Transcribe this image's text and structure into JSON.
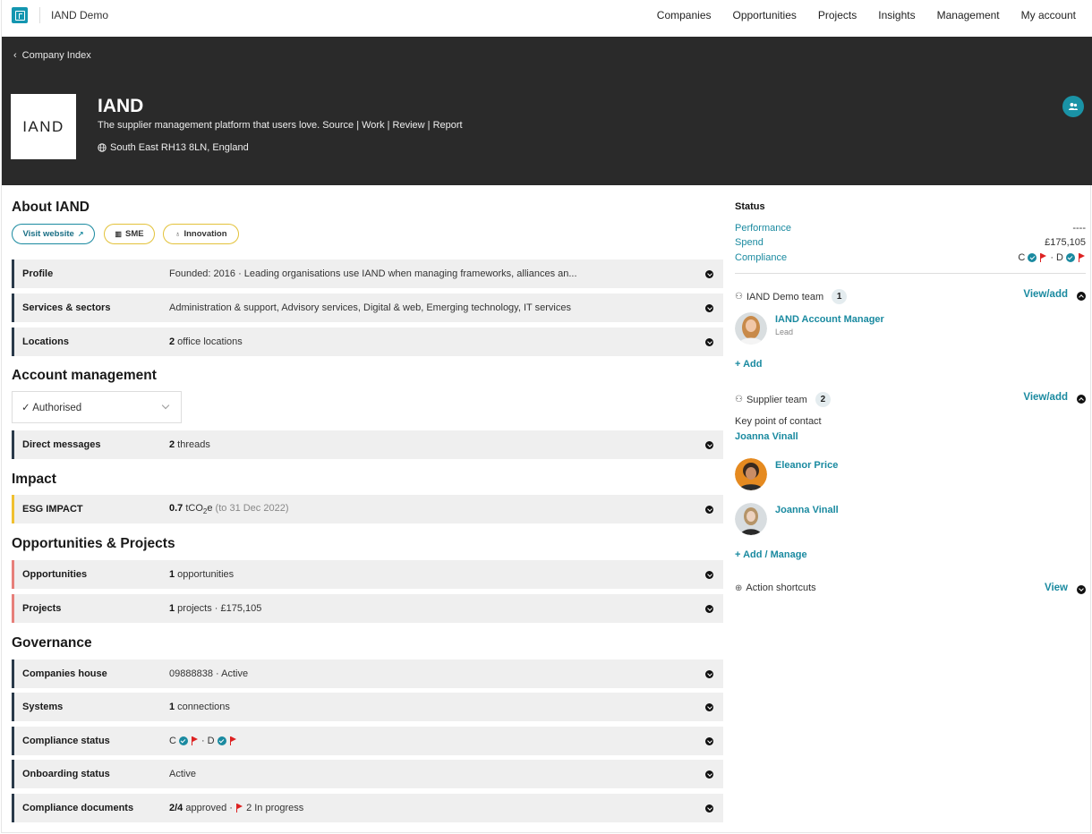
{
  "app": {
    "title": "IAND Demo"
  },
  "nav": [
    "Companies",
    "Opportunities",
    "Projects",
    "Insights",
    "Management",
    "My account"
  ],
  "hero": {
    "back": "Company Index",
    "logo_text": "IAND",
    "name": "IAND",
    "tagline": "The supplier management platform that users love. Source | Work | Review | Report",
    "location": "South East RH13 8LN, England"
  },
  "about": {
    "title": "About IAND",
    "pills": {
      "website": "Visit website",
      "sme": "SME",
      "innovation": "Innovation"
    },
    "rows": [
      {
        "label": "Profile",
        "value": "Founded: 2016 · Leading organisations use IAND when managing frameworks, alliances an..."
      },
      {
        "label": "Services & sectors",
        "value": "Administration & support, Advisory services, Digital & web, Emerging technology, IT services"
      },
      {
        "label": "Locations",
        "bold": "2",
        "value": " office locations"
      }
    ]
  },
  "account": {
    "title": "Account management",
    "select_value": "✓ Authorised",
    "dm_label": "Direct messages",
    "dm_bold": "2",
    "dm_value": " threads"
  },
  "impact": {
    "title": "Impact",
    "label": "ESG IMPACT",
    "bold": "0.7",
    "unit": " tCO",
    "unit_sub": "2",
    "unit_end": "e",
    "muted": " (to 31 Dec 2022)"
  },
  "opps": {
    "title": "Opportunities & Projects",
    "opp_label": "Opportunities",
    "opp_bold": "1",
    "opp_value": " opportunities",
    "proj_label": "Projects",
    "proj_bold": "1",
    "proj_value": " projects · £175,105"
  },
  "governance": {
    "title": "Governance",
    "ch_label": "Companies house",
    "ch_value": "09888838 · Active",
    "sys_label": "Systems",
    "sys_bold": "1",
    "sys_value": " connections",
    "comp_label": "Compliance status",
    "comp_c": "C",
    "comp_sep": "· D",
    "onb_label": "Onboarding status",
    "onb_value": "Active",
    "docs_label": "Compliance documents",
    "docs_bold": "2/4",
    "docs_value": " approved · ",
    "docs_progress": "2 In progress"
  },
  "status": {
    "title": "Status",
    "performance_label": "Performance",
    "performance_value": "----",
    "spend_label": "Spend",
    "spend_value": "£175,105",
    "compliance_label": "Compliance",
    "comp_c": "C",
    "comp_sep": "· D"
  },
  "iand_team": {
    "title": "IAND Demo team",
    "count": "1",
    "view_add": "View/add",
    "member_name": "IAND Account Manager",
    "member_role": "Lead",
    "add": "+ Add"
  },
  "supplier_team": {
    "title": "Supplier team",
    "count": "2",
    "view_add": "View/add",
    "kpc_label": "Key point of contact",
    "kpc_name": "Joanna Vinall",
    "member1": "Eleanor Price",
    "member2": "Joanna Vinall",
    "add_manage": "+ Add / Manage"
  },
  "shortcuts": {
    "title": "Action shortcuts",
    "view": "View"
  },
  "colors": {
    "accent": "#1a8aa0",
    "dark": "#2a2a2a",
    "flag": "#dd2222",
    "yellow": "#f0c030",
    "red": "#e77f7a"
  }
}
